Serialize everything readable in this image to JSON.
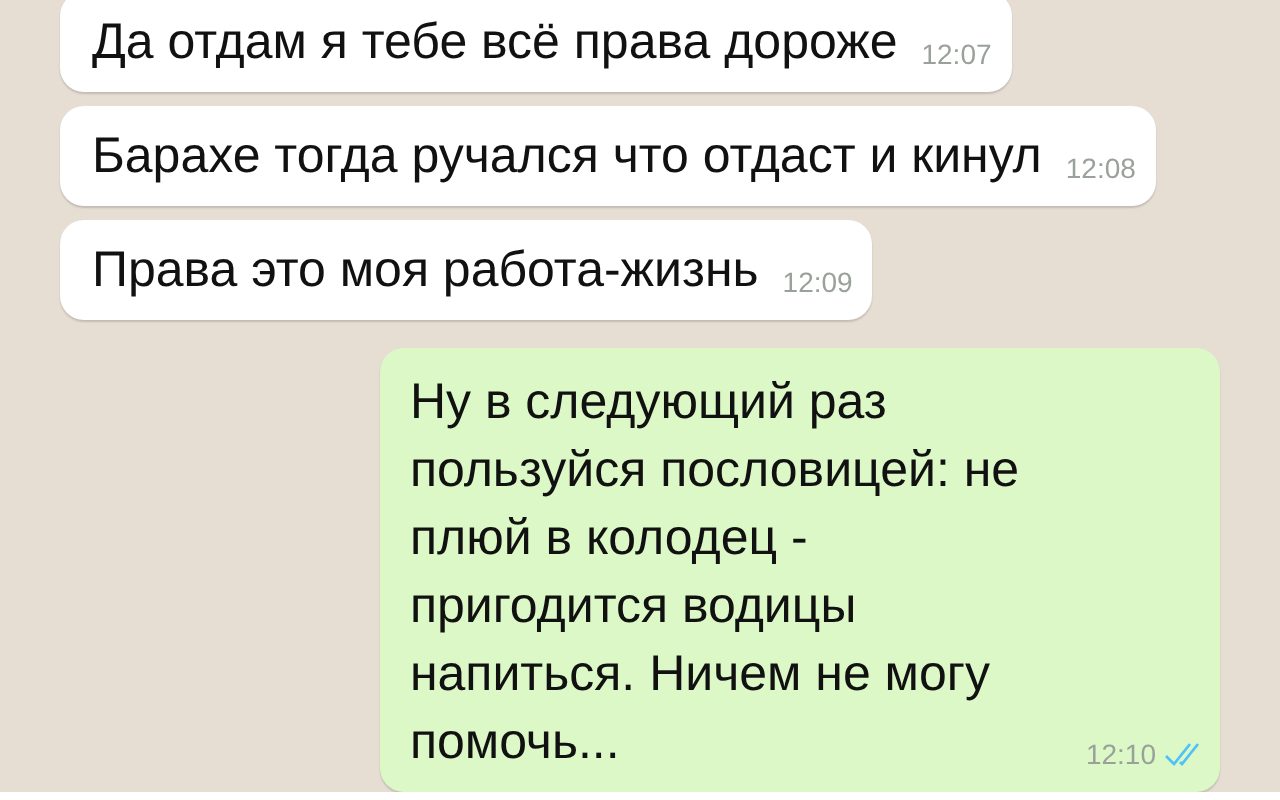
{
  "messages": [
    {
      "kind": "incoming",
      "text": "Да отдам я тебе всё права дороже",
      "time": "12:07"
    },
    {
      "kind": "incoming",
      "text": "Барахе тогда ручался что отдаст и кинул",
      "time": "12:08"
    },
    {
      "kind": "incoming",
      "text": "Права это моя работа-жизнь",
      "time": "12:09"
    },
    {
      "kind": "outgoing",
      "text": "Ну в следующий раз пользуйся пословицей: не плюй в колодец - пригодится водицы напиться. Ничем не могу помочь...",
      "time": "12:10",
      "read": true
    }
  ]
}
